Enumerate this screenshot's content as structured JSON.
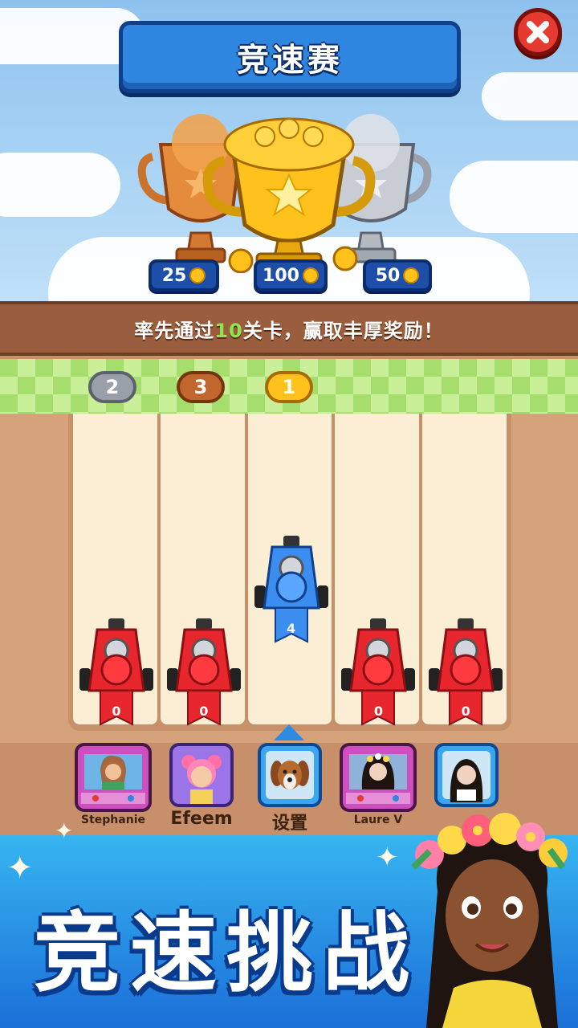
{
  "header": {
    "title": "竞速赛",
    "close_icon": "close-icon"
  },
  "prizes": [
    {
      "amount": "25",
      "trophy": "bronze"
    },
    {
      "amount": "100",
      "trophy": "gold"
    },
    {
      "amount": "50",
      "trophy": "silver"
    }
  ],
  "info": {
    "prefix": "率先通过",
    "number": "10",
    "suffix": "关卡，赢取丰厚奖励！"
  },
  "ranks": [
    {
      "rank": "2",
      "medal": "silver"
    },
    {
      "rank": "3",
      "medal": "bronze"
    },
    {
      "rank": "1",
      "medal": "gold"
    }
  ],
  "lanes": [
    {
      "score": "0",
      "color": "#e8262e",
      "leading": false
    },
    {
      "score": "0",
      "color": "#e8262e",
      "leading": false
    },
    {
      "score": "4",
      "color": "#3b8ef0",
      "leading": true
    },
    {
      "score": "0",
      "color": "#e8262e",
      "leading": false
    },
    {
      "score": "0",
      "color": "#e8262e",
      "leading": false
    }
  ],
  "players": [
    {
      "name": "Stephanie"
    },
    {
      "name": "Efeem"
    },
    {
      "name": "设置"
    },
    {
      "name": "Laure V"
    },
    {
      "name": ""
    }
  ],
  "banner": {
    "title": "竞速挑战"
  },
  "colors": {
    "sky": "#8ec2ee",
    "title_blue": "#2f86e0",
    "bar_brown": "#9a5e3e",
    "highlight_green": "#8ee64e",
    "close_red": "#e43a2f"
  }
}
